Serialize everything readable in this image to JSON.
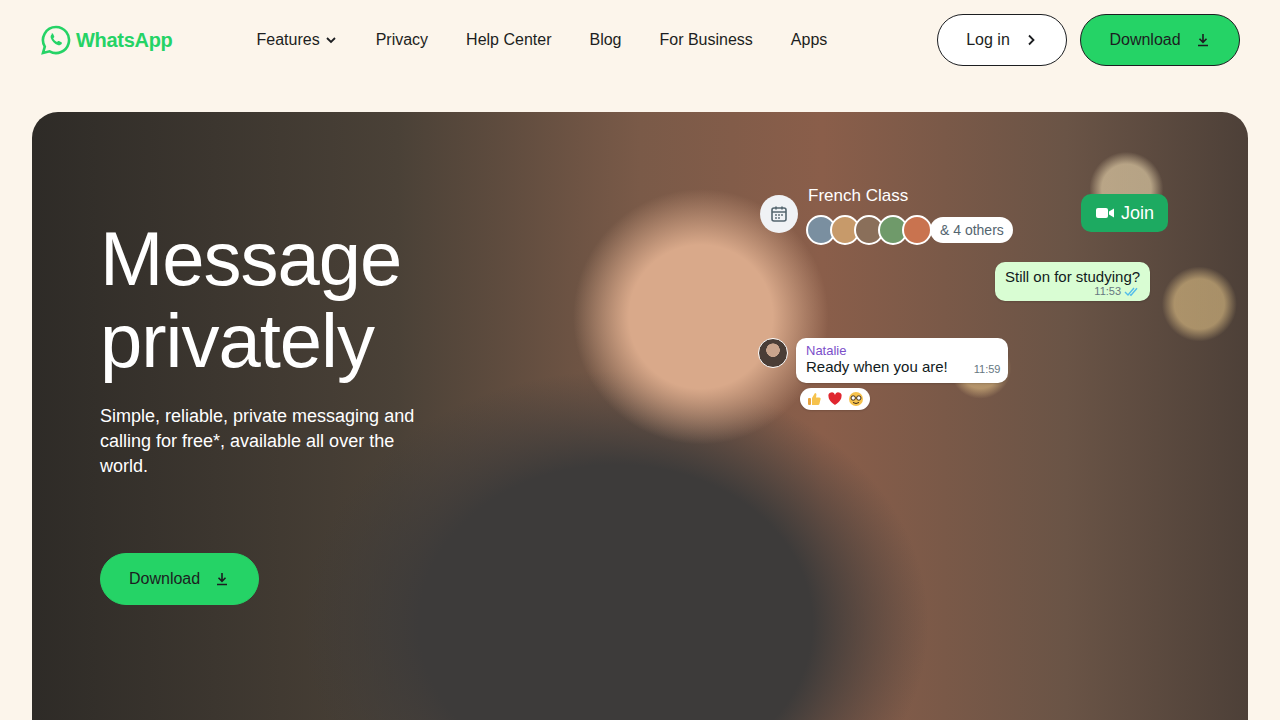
{
  "header": {
    "logo": "WhatsApp",
    "nav": [
      {
        "label": "Features",
        "has_dropdown": true
      },
      {
        "label": "Privacy",
        "has_dropdown": false
      },
      {
        "label": "Help Center",
        "has_dropdown": false
      },
      {
        "label": "Blog",
        "has_dropdown": false
      },
      {
        "label": "For Business",
        "has_dropdown": false
      },
      {
        "label": "Apps",
        "has_dropdown": false
      }
    ],
    "login": "Log in",
    "download": "Download"
  },
  "hero": {
    "title_lines": [
      "Message",
      "privately"
    ],
    "subtitle": "Simple, reliable, private messaging and calling for free*, available all over the world.",
    "download": "Download"
  },
  "chat": {
    "event": {
      "title": "French Class",
      "others": "& 4 others",
      "join": "Join"
    },
    "messages": [
      {
        "kind": "outgoing",
        "sender": "",
        "text": "Still on for studying?",
        "time": "11:53",
        "read": true,
        "has_reactions": false
      },
      {
        "kind": "incoming",
        "sender": "Natalie",
        "text": "Ready when you are!",
        "time": "11:59",
        "read": false,
        "has_reactions": true
      }
    ]
  }
}
